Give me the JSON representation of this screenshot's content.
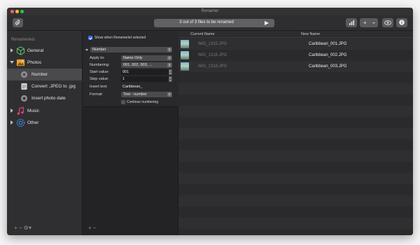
{
  "window": {
    "title": "Renamer"
  },
  "toolbar": {
    "status": "3 out of 3 files to be renamed",
    "add_label": "+"
  },
  "sidebar": {
    "header": "Renamerlets",
    "items": [
      {
        "label": "General",
        "icon": "cube-icon"
      },
      {
        "label": "Photos",
        "icon": "photos-icon"
      },
      {
        "label": "Number",
        "icon": "gear-icon"
      },
      {
        "label": "Convert .JPEG to .jpg",
        "icon": "document-icon"
      },
      {
        "label": "Insert photo date",
        "icon": "gear-icon"
      },
      {
        "label": "Music",
        "icon": "music-note-icon"
      },
      {
        "label": "Other",
        "icon": "gear-icon"
      }
    ],
    "footer": "+ − ⚙▾"
  },
  "options": {
    "show_when_selected": "Show when Renamerlet selected",
    "renamerlet": "Number",
    "apply_to_label": "Apply to:",
    "apply_to_value": "Name Only",
    "numbering_label": "Numbering:",
    "numbering_value": "001, 002, 003, ...",
    "start_value_label": "Start value:",
    "start_value": "001",
    "step_value_label": "Step value:",
    "step_value": "1",
    "insert_text_label": "Insert text:",
    "insert_text_value": "Caribbean_",
    "format_label": "Format:",
    "format_value": "Text - number",
    "continue_numbering": "Continue numbering",
    "footer": "+ −"
  },
  "file_list": {
    "col_current": "Current Name",
    "col_new": "New Name",
    "rows": [
      {
        "current": "IMG_1315.JPG",
        "new": "Caribbean_001.JPG"
      },
      {
        "current": "IMG_1316.JPG",
        "new": "Caribbean_002.JPG"
      },
      {
        "current": "IMG_1318.JPG",
        "new": "Caribbean_003.JPG"
      }
    ]
  },
  "colors": {
    "accent": "#2d72ff",
    "close": "#fe5f57",
    "minimize": "#febc2e",
    "zoom": "#28c840"
  }
}
